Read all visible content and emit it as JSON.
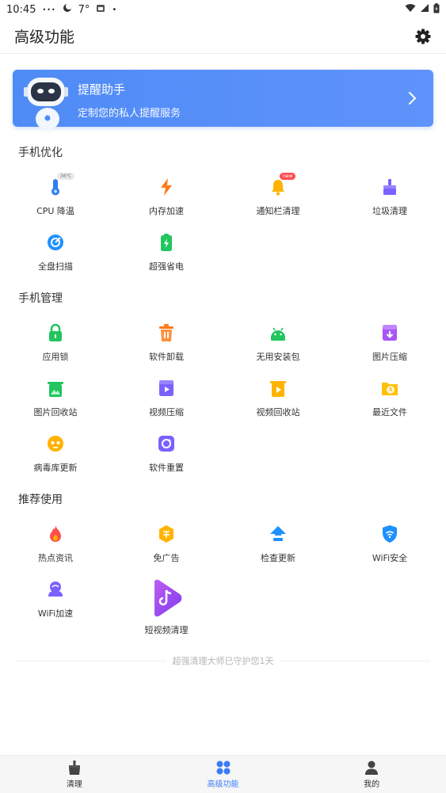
{
  "status_bar": {
    "time": "10:45",
    "temperature": "7°",
    "dots": "•••",
    "dot": "•"
  },
  "app_bar": {
    "title": "高级功能"
  },
  "banner": {
    "title": "提醒助手",
    "subtitle": "定制您的私人提醒服务"
  },
  "sections": {
    "optimize": {
      "title": "手机优化",
      "items": [
        {
          "label": "CPU 降温",
          "badge": "36℃"
        },
        {
          "label": "内存加速"
        },
        {
          "label": "通知栏清理",
          "badge": "new"
        },
        {
          "label": "垃圾清理"
        },
        {
          "label": "全盘扫描"
        },
        {
          "label": "超强省电"
        }
      ]
    },
    "manage": {
      "title": "手机管理",
      "items": [
        {
          "label": "应用锁"
        },
        {
          "label": "软件卸载"
        },
        {
          "label": "无用安装包"
        },
        {
          "label": "图片压缩"
        },
        {
          "label": "图片回收站"
        },
        {
          "label": "视频压缩"
        },
        {
          "label": "视频回收站"
        },
        {
          "label": "最近文件"
        },
        {
          "label": "病毒库更新"
        },
        {
          "label": "软件重置"
        }
      ]
    },
    "recommend": {
      "title": "推荐使用",
      "items": [
        {
          "label": "热点资讯"
        },
        {
          "label": "免广告"
        },
        {
          "label": "检查更新"
        },
        {
          "label": "WiFi安全"
        },
        {
          "label": "WiFi加速"
        },
        {
          "label": "短视频清理"
        }
      ]
    }
  },
  "footer_note": "超强清理大师已守护您1天",
  "bottom_nav": {
    "items": [
      {
        "label": "清理"
      },
      {
        "label": "高级功能"
      },
      {
        "label": "我的"
      }
    ]
  },
  "colors": {
    "accent": "#3b7cf6",
    "banner": "#5a90fa"
  }
}
